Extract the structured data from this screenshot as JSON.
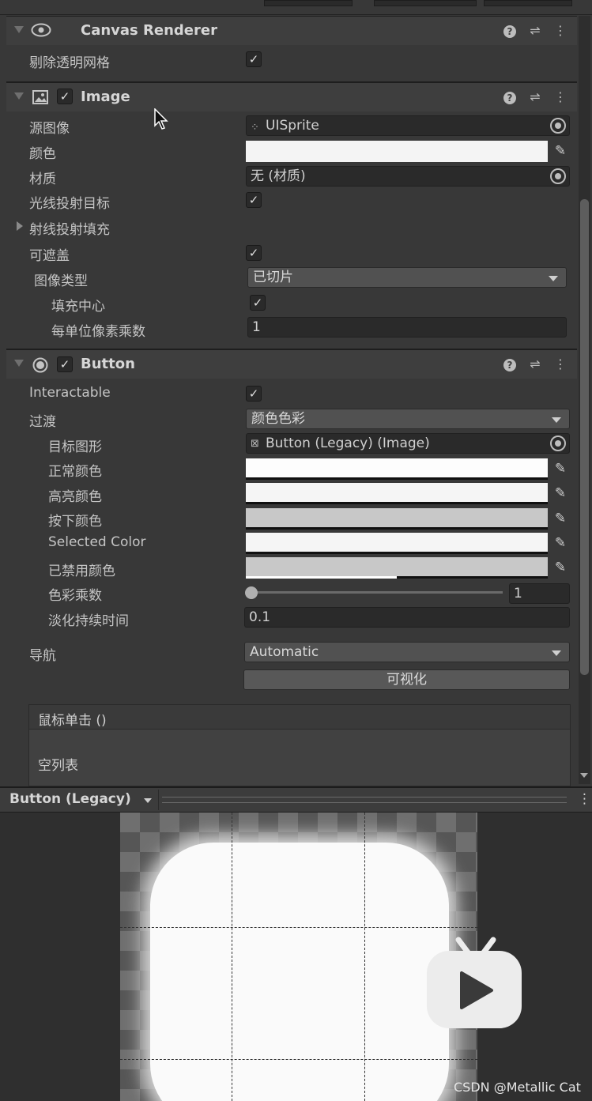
{
  "canvas_renderer": {
    "title": "Canvas Renderer",
    "cull_transparent_label": "剔除透明网格"
  },
  "image": {
    "title": "Image",
    "source_label": "源图像",
    "source_value": "UISprite",
    "color_label": "颜色",
    "material_label": "材质",
    "material_value": "无 (材质)",
    "raycast_target_label": "光线投射目标",
    "raycast_padding_label": "射线投射填充",
    "maskable_label": "可遮盖",
    "image_type_label": "图像类型",
    "image_type_value": "已切片",
    "fill_center_label": "填充中心",
    "ppu_label": "每单位像素乘数",
    "ppu_value": "1"
  },
  "button": {
    "title": "Button",
    "interactable_label": "Interactable",
    "transition_label": "过渡",
    "transition_value": "颜色色彩",
    "target_graphic_label": "目标图形",
    "target_graphic_value": "Button (Legacy) (Image)",
    "normal_color_label": "正常颜色",
    "highlighted_color_label": "高亮颜色",
    "pressed_color_label": "按下颜色",
    "selected_color_label": "Selected Color",
    "disabled_color_label": "已禁用颜色",
    "color_multiplier_label": "色彩乘数",
    "color_multiplier_value": "1",
    "fade_duration_label": "淡化持续时间",
    "fade_duration_value": "0.1",
    "navigation_label": "导航",
    "navigation_value": "Automatic",
    "visualize_label": "可视化",
    "onclick_label": "鼠标单击 ()",
    "onclick_empty": "空列表"
  },
  "preview": {
    "title": "Button (Legacy)"
  },
  "watermark": "CSDN @Metallic Cat",
  "colors": {
    "panel_bg": "#383838",
    "header_bg": "#3e3e3e",
    "field_bg": "#2a2a2a",
    "dropdown_bg": "#515151"
  }
}
